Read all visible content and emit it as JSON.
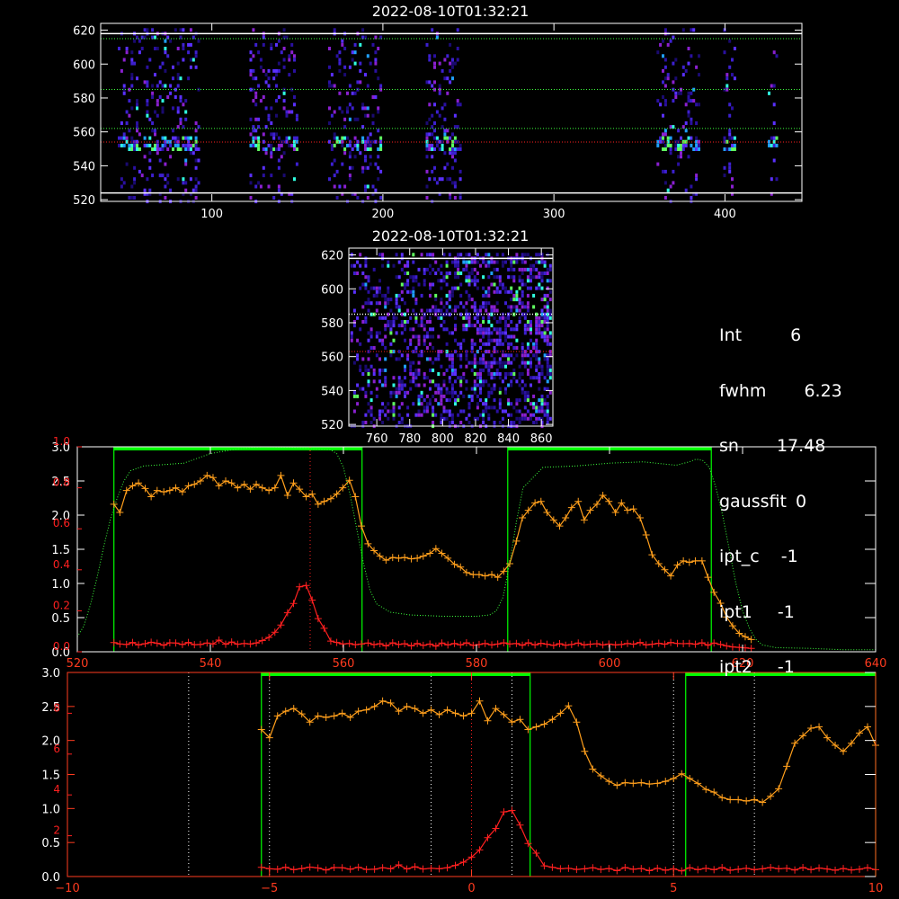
{
  "colors": {
    "background": "#000000",
    "axes": "#ffffff",
    "lower_axes": "#ff3b1f",
    "orange": "#ff9f1c",
    "red": "#ff2020",
    "green_limits": "#00ff00",
    "green_dotted": "#3cff3c",
    "white_dotted": "#ffffff",
    "pixels": [
      "#1a0a70",
      "#2a10a0",
      "#3d20d0",
      "#5a30ff",
      "#8a20d0",
      "#20a0ff",
      "#30ffe0",
      "#60ff60"
    ]
  },
  "info_panel": [
    {
      "key": "Int",
      "value": "6"
    },
    {
      "key": "fwhm",
      "value": "6.23"
    },
    {
      "key": "sn",
      "value": "17.48"
    },
    {
      "key": "gaussfit",
      "value": "0"
    },
    {
      "key": "ipt_c",
      "value": "-1"
    },
    {
      "key": "ipt1",
      "value": "-1"
    },
    {
      "key": "ipt2",
      "value": "-1"
    }
  ],
  "chart_data": [
    {
      "type": "heatmap",
      "title": "2022-08-10T01:32:21",
      "xlim": [
        35,
        445
      ],
      "ylim": [
        519,
        624
      ],
      "xticks": [
        "100",
        "200",
        "300",
        "400"
      ],
      "yticks": [
        "520",
        "540",
        "560",
        "580",
        "600",
        "620"
      ],
      "column_bands": [
        [
          45,
          92
        ],
        [
          122,
          150
        ],
        [
          168,
          198
        ],
        [
          225,
          245
        ],
        [
          360,
          385
        ],
        [
          399,
          406
        ],
        [
          425,
          430
        ]
      ],
      "bright_row": 554,
      "white_hlines": [
        618,
        524
      ],
      "green_dotted_hlines": [
        615,
        585,
        562
      ],
      "red_dotted_hline": 554
    },
    {
      "type": "heatmap",
      "title": "2022-08-10T01:32:21",
      "xlim": [
        743,
        867
      ],
      "ylim": [
        519,
        624
      ],
      "xticks": [
        "760",
        "780",
        "800",
        "820",
        "840",
        "860"
      ],
      "yticks": [
        "520",
        "540",
        "560",
        "580",
        "600",
        "620"
      ],
      "white_hlines": [
        618,
        585
      ],
      "red_dotted_hline": 563
    },
    {
      "type": "line",
      "xlim": [
        520,
        640
      ],
      "ylim": [
        0,
        3.0
      ],
      "xticks": [
        "520",
        "540",
        "560",
        "580",
        "600",
        "620",
        "640"
      ],
      "yticks_left": [
        "0.0",
        "0.5",
        "1.0",
        "1.5",
        "2.0",
        "2.5",
        "3.0"
      ],
      "yticks_red": [
        "0.0",
        "0.2",
        "0.4",
        "0.6",
        "0.8",
        "1.0"
      ],
      "green_boxes": [
        [
          525.5,
          562.8
        ],
        [
          584.7,
          615.3
        ]
      ],
      "red_dotted_vline": 555,
      "series": [
        {
          "color": "orange",
          "x": [
            525.5,
            526.4,
            527.4,
            528.3,
            529.2,
            530.2,
            531.1,
            532.0,
            533.0,
            533.9,
            534.8,
            535.8,
            536.7,
            537.6,
            538.5,
            539.5,
            540.4,
            541.3,
            542.3,
            543.2,
            544.1,
            545.1,
            546.0,
            546.9,
            547.8,
            548.8,
            549.7,
            550.6,
            551.6,
            552.5,
            553.4,
            554.4,
            555.3,
            556.2,
            557.1,
            558.1,
            559.0,
            559.9,
            560.9,
            561.8,
            562.7,
            563.7,
            564.6,
            565.5,
            566.4,
            567.4,
            568.3,
            569.2,
            570.2,
            571.1,
            572.0,
            573.0,
            573.9,
            574.8,
            575.7,
            576.7,
            577.6,
            578.5,
            579.5,
            580.4,
            581.3,
            582.3,
            583.2,
            584.1,
            585.0,
            586.0,
            586.9,
            587.8,
            588.8,
            589.7,
            590.6,
            591.6,
            592.5,
            593.4,
            594.3,
            595.3,
            596.2,
            597.1,
            598.1,
            599.0,
            599.9,
            600.9,
            601.8,
            602.7,
            603.6,
            604.6,
            605.5,
            606.4,
            607.4,
            608.3,
            609.2,
            610.2,
            611.1,
            612.0,
            612.9,
            613.9,
            614.8,
            615.7,
            616.7,
            617.6,
            618.5,
            619.5,
            620.4,
            621.3
          ],
          "values": [
            2.16,
            2.04,
            2.36,
            2.43,
            2.47,
            2.39,
            2.27,
            2.36,
            2.34,
            2.36,
            2.4,
            2.34,
            2.43,
            2.45,
            2.5,
            2.58,
            2.55,
            2.43,
            2.5,
            2.47,
            2.4,
            2.45,
            2.38,
            2.45,
            2.4,
            2.36,
            2.4,
            2.58,
            2.29,
            2.47,
            2.38,
            2.27,
            2.31,
            2.16,
            2.2,
            2.24,
            2.31,
            2.4,
            2.51,
            2.27,
            1.84,
            1.58,
            1.48,
            1.4,
            1.34,
            1.38,
            1.37,
            1.38,
            1.36,
            1.37,
            1.4,
            1.44,
            1.51,
            1.44,
            1.37,
            1.28,
            1.24,
            1.16,
            1.13,
            1.13,
            1.11,
            1.13,
            1.09,
            1.18,
            1.29,
            1.62,
            1.96,
            2.07,
            2.18,
            2.2,
            2.04,
            1.93,
            1.84,
            1.96,
            2.11,
            2.2,
            1.93,
            2.07,
            2.16,
            2.29,
            2.2,
            2.04,
            2.18,
            2.07,
            2.09,
            1.96,
            1.71,
            1.42,
            1.29,
            1.2,
            1.11,
            1.27,
            1.33,
            1.31,
            1.33,
            1.33,
            1.09,
            0.87,
            0.71,
            0.51,
            0.38,
            0.27,
            0.22,
            0.18
          ]
        },
        {
          "color": "red",
          "x": [
            525.5,
            526.4,
            527.4,
            528.3,
            529.2,
            530.2,
            531.1,
            532.0,
            533.0,
            533.9,
            534.8,
            535.8,
            536.7,
            537.6,
            538.5,
            539.5,
            540.4,
            541.3,
            542.3,
            543.2,
            544.1,
            545.1,
            546.0,
            546.9,
            547.8,
            548.8,
            549.7,
            550.6,
            551.6,
            552.5,
            553.4,
            554.4,
            555.3,
            556.2,
            557.1,
            558.1,
            559.0,
            559.9,
            560.9,
            561.8,
            562.7,
            563.7,
            564.6,
            565.5,
            566.4,
            567.4,
            568.3,
            569.2,
            570.2,
            571.1,
            572.0,
            573.0,
            573.9,
            574.8,
            575.7,
            576.7,
            577.6,
            578.5,
            579.5,
            580.4,
            581.3,
            582.3,
            583.2,
            584.1,
            585.0,
            586.0,
            586.9,
            587.8,
            588.8,
            589.7,
            590.6,
            591.6,
            592.5,
            593.4,
            594.3,
            595.3,
            596.2,
            597.1,
            598.1,
            599.0,
            599.9,
            600.9,
            601.8,
            602.7,
            603.6,
            604.6,
            605.5,
            606.4,
            607.4,
            608.3,
            609.2,
            610.2,
            611.1,
            612.0,
            612.9,
            613.9,
            614.8,
            615.7,
            616.7,
            617.6,
            618.5,
            619.5,
            620.4,
            621.3
          ],
          "values": [
            0.135,
            0.114,
            0.107,
            0.136,
            0.1,
            0.118,
            0.139,
            0.125,
            0.096,
            0.132,
            0.129,
            0.107,
            0.136,
            0.104,
            0.107,
            0.129,
            0.114,
            0.171,
            0.111,
            0.143,
            0.111,
            0.121,
            0.114,
            0.129,
            0.164,
            0.211,
            0.286,
            0.392,
            0.571,
            0.707,
            0.95,
            0.971,
            0.757,
            0.486,
            0.343,
            0.157,
            0.136,
            0.114,
            0.121,
            0.104,
            0.114,
            0.129,
            0.104,
            0.118,
            0.086,
            0.132,
            0.107,
            0.118,
            0.086,
            0.121,
            0.093,
            0.114,
            0.082,
            0.129,
            0.1,
            0.121,
            0.1,
            0.132,
            0.093,
            0.107,
            0.121,
            0.1,
            0.114,
            0.132,
            0.114,
            0.121,
            0.096,
            0.132,
            0.1,
            0.125,
            0.111,
            0.093,
            0.118,
            0.096,
            0.107,
            0.129,
            0.1,
            0.111,
            0.118,
            0.1,
            0.114,
            0.1,
            0.107,
            0.121,
            0.111,
            0.136,
            0.1,
            0.111,
            0.125,
            0.111,
            0.136,
            0.121,
            0.118,
            0.121,
            0.111,
            0.132,
            0.096,
            0.129,
            0.107,
            0.086,
            0.071,
            0.064,
            0.057,
            0.05
          ]
        },
        {
          "color": "green_dotted",
          "x": [
            520,
            521,
            522,
            523,
            524,
            525,
            526,
            527,
            528,
            530,
            533,
            536,
            540,
            544,
            548,
            552,
            556,
            558,
            559,
            560,
            561,
            562,
            563,
            564,
            565,
            567,
            570,
            575,
            580,
            582,
            583,
            584,
            585,
            586,
            587,
            590,
            595,
            600,
            605,
            610,
            612,
            613,
            614,
            615,
            616,
            617,
            618,
            619,
            620,
            621,
            622,
            623,
            625,
            630,
            635,
            640
          ],
          "values": [
            0.22,
            0.38,
            0.7,
            1.1,
            1.55,
            1.95,
            2.25,
            2.5,
            2.65,
            2.72,
            2.74,
            2.76,
            2.9,
            2.97,
            3.0,
            2.99,
            2.97,
            2.96,
            2.9,
            2.7,
            2.3,
            1.8,
            1.3,
            0.9,
            0.7,
            0.58,
            0.54,
            0.52,
            0.52,
            0.54,
            0.6,
            0.8,
            1.3,
            1.9,
            2.4,
            2.7,
            2.72,
            2.76,
            2.78,
            2.73,
            2.78,
            2.82,
            2.8,
            2.7,
            2.4,
            2.0,
            1.5,
            1.0,
            0.6,
            0.35,
            0.18,
            0.1,
            0.06,
            0.05,
            0.03,
            0.03
          ]
        }
      ]
    },
    {
      "type": "line",
      "xlim": [
        -10,
        10
      ],
      "ylim": [
        0,
        3.0
      ],
      "xticks": [
        "−10",
        "−5",
        "0",
        "5",
        "10"
      ],
      "yticks_left": [
        "0.0",
        "0.5",
        "1.0",
        "1.5",
        "2.0",
        "2.5",
        "3.0"
      ],
      "yticks_red": [
        "2",
        "4",
        "6",
        "8"
      ],
      "green_boxes": [
        [
          -5.2,
          1.45
        ],
        [
          5.3,
          10
        ]
      ],
      "white_dotted_vlines": [
        -7.0,
        -5.0,
        -1.0,
        1.0,
        5.0,
        7.0
      ],
      "red_dotted_vline": 0,
      "series": [
        {
          "color": "orange",
          "x": [
            -5.2,
            -5.0,
            -4.8,
            -4.6,
            -4.4,
            -4.2,
            -4.0,
            -3.8,
            -3.6,
            -3.4,
            -3.2,
            -3.0,
            -2.8,
            -2.6,
            -2.4,
            -2.2,
            -2.0,
            -1.8,
            -1.6,
            -1.4,
            -1.2,
            -1.0,
            -0.8,
            -0.6,
            -0.4,
            -0.2,
            0.0,
            0.2,
            0.4,
            0.6,
            0.8,
            1.0,
            1.2,
            1.4,
            1.6,
            1.8,
            2.0,
            2.2,
            2.4,
            2.6,
            2.8,
            3.0,
            3.2,
            3.4,
            3.6,
            3.8,
            4.0,
            4.2,
            4.4,
            4.6,
            4.8,
            5.0,
            5.2,
            5.4,
            5.6,
            5.8,
            6.0,
            6.2,
            6.4,
            6.6,
            6.8,
            7.0,
            7.2,
            7.4,
            7.6,
            7.8,
            8.0,
            8.2,
            8.4,
            8.6,
            8.8,
            9.0,
            9.2,
            9.4,
            9.6,
            9.8,
            10.0
          ],
          "values": [
            2.16,
            2.04,
            2.36,
            2.43,
            2.47,
            2.39,
            2.27,
            2.36,
            2.34,
            2.36,
            2.4,
            2.34,
            2.43,
            2.45,
            2.5,
            2.58,
            2.55,
            2.43,
            2.5,
            2.47,
            2.4,
            2.45,
            2.38,
            2.45,
            2.4,
            2.36,
            2.4,
            2.58,
            2.29,
            2.47,
            2.38,
            2.27,
            2.31,
            2.16,
            2.2,
            2.24,
            2.31,
            2.4,
            2.51,
            2.27,
            1.84,
            1.58,
            1.48,
            1.4,
            1.34,
            1.38,
            1.37,
            1.38,
            1.36,
            1.37,
            1.4,
            1.44,
            1.51,
            1.44,
            1.37,
            1.28,
            1.24,
            1.16,
            1.13,
            1.13,
            1.11,
            1.13,
            1.09,
            1.18,
            1.29,
            1.62,
            1.96,
            2.07,
            2.18,
            2.2,
            2.04,
            1.93,
            1.84,
            1.96,
            2.11,
            2.2,
            1.93
          ]
        },
        {
          "color": "red",
          "x": [
            -5.2,
            -5.0,
            -4.8,
            -4.6,
            -4.4,
            -4.2,
            -4.0,
            -3.8,
            -3.6,
            -3.4,
            -3.2,
            -3.0,
            -2.8,
            -2.6,
            -2.4,
            -2.2,
            -2.0,
            -1.8,
            -1.6,
            -1.4,
            -1.2,
            -1.0,
            -0.8,
            -0.6,
            -0.4,
            -0.2,
            0.0,
            0.2,
            0.4,
            0.6,
            0.8,
            1.0,
            1.2,
            1.4,
            1.6,
            1.8,
            2.0,
            2.2,
            2.4,
            2.6,
            2.8,
            3.0,
            3.2,
            3.4,
            3.6,
            3.8,
            4.0,
            4.2,
            4.4,
            4.6,
            4.8,
            5.0,
            5.2,
            5.4,
            5.6,
            5.8,
            6.0,
            6.2,
            6.4,
            6.6,
            6.8,
            7.0,
            7.2,
            7.4,
            7.6,
            7.8,
            8.0,
            8.2,
            8.4,
            8.6,
            8.8,
            9.0,
            9.2,
            9.4,
            9.6,
            9.8,
            10.0
          ],
          "values": [
            0.135,
            0.114,
            0.107,
            0.136,
            0.1,
            0.118,
            0.139,
            0.125,
            0.096,
            0.132,
            0.129,
            0.107,
            0.136,
            0.104,
            0.107,
            0.129,
            0.114,
            0.171,
            0.111,
            0.143,
            0.111,
            0.121,
            0.114,
            0.129,
            0.164,
            0.211,
            0.286,
            0.392,
            0.571,
            0.707,
            0.95,
            0.971,
            0.757,
            0.486,
            0.343,
            0.157,
            0.136,
            0.114,
            0.121,
            0.104,
            0.114,
            0.129,
            0.104,
            0.118,
            0.086,
            0.132,
            0.107,
            0.118,
            0.086,
            0.121,
            0.093,
            0.114,
            0.082,
            0.129,
            0.1,
            0.121,
            0.1,
            0.132,
            0.093,
            0.107,
            0.121,
            0.1,
            0.114,
            0.132,
            0.114,
            0.121,
            0.096,
            0.132,
            0.1,
            0.125,
            0.111,
            0.093,
            0.118,
            0.096,
            0.107,
            0.129,
            0.1
          ]
        }
      ]
    }
  ]
}
